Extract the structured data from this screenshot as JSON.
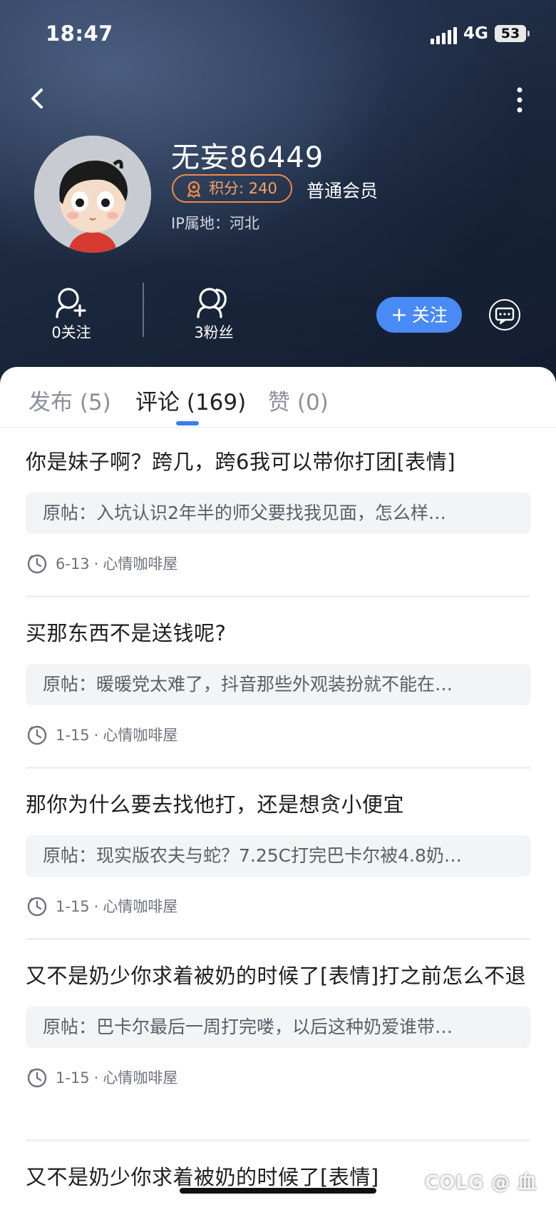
{
  "status_bar": {
    "time": "18:47",
    "network": "4G",
    "battery": "53"
  },
  "profile": {
    "username": "无妄86449",
    "points_label": "积分: 240",
    "member_level": "普通会员",
    "ip_location": "IP属地：河北"
  },
  "stats": {
    "following": "0关注",
    "fans": "3粉丝"
  },
  "actions": {
    "follow": "关注"
  },
  "tabs": [
    {
      "label": "发布 (5)"
    },
    {
      "label": "评论 (169)"
    },
    {
      "label": "赞 (0)"
    }
  ],
  "comments": [
    {
      "text": "你是妹子啊？跨几，跨6我可以带你打团[表情]",
      "orig_label": "原帖：",
      "orig": "入坑认识2年半的师父要找我见面，怎么样…",
      "date": "6-13",
      "forum": "心情咖啡屋"
    },
    {
      "text": "买那东西不是送钱呢?",
      "orig_label": "原帖：",
      "orig": "暖暖党太难了，抖音那些外观装扮就不能在…",
      "date": "1-15",
      "forum": "心情咖啡屋"
    },
    {
      "text": "那你为什么要去找他打，还是想贪小便宜",
      "orig_label": "原帖：",
      "orig": "现实版农夫与蛇？7.25C打完巴卡尔被4.8奶…",
      "date": "1-15",
      "forum": "心情咖啡屋"
    },
    {
      "text": "又不是奶少你求着被奶的时候了[表情]打之前怎么不退",
      "orig_label": "原帖：",
      "orig": "巴卡尔最后一周打完喽，以后这种奶爱谁带…",
      "date": "1-15",
      "forum": "心情咖啡屋"
    },
    {
      "text": "又不是奶少你求着被奶的时候了[表情]"
    }
  ],
  "meta_separator": "·",
  "watermark": "COLG @ 血",
  "colors": {
    "accent_blue": "#4a8af5",
    "badge_orange": "#f0894a",
    "header_dark": "#1c2940"
  }
}
